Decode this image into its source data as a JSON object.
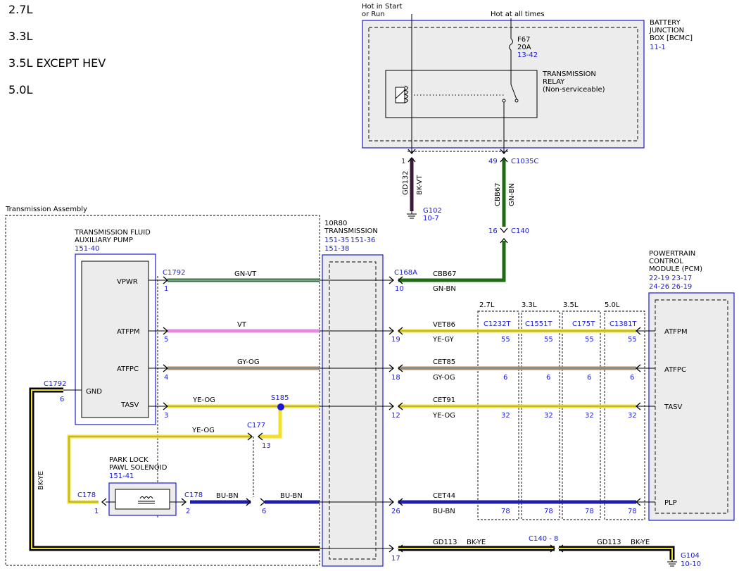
{
  "engines": [
    "2.7L",
    "3.3L",
    "3.5L EXCEPT HEV",
    "5.0L"
  ],
  "colors": {
    "blue": "#1a1ad6",
    "box_fill": "#ececec",
    "green": "#1f6b14",
    "gn_vt_stroke": "#2f6b3a",
    "violet": "#e38be0",
    "yellow": "#f1e02a",
    "gy_og": "#b08a6a",
    "bu_bn": "#1e1ea8",
    "bk_ye": "#000000"
  },
  "power": {
    "hot_start_run": [
      "Hot in Start",
      "or Run"
    ],
    "hot_all_times": "Hot at all times"
  },
  "bjb": {
    "label": [
      "BATTERY",
      "JUNCTION",
      "BOX [BCMC]"
    ],
    "ref": "11-1",
    "fuse": "F67",
    "fuse_rating": "20A",
    "fuse_ref": "13-42",
    "relay_label": [
      "TRANSMISSION",
      "RELAY",
      "(Non-serviceable)"
    ]
  },
  "top_wires": {
    "left_pin": "1",
    "left_circuit": "GD132",
    "left_color": "BK-VT",
    "ground": "G102",
    "ground_ref": "10-7",
    "right_pin": "49",
    "connector": "C1035C",
    "right_circuit": "CBB67",
    "right_color": "GN-BN",
    "c140_pin": "16",
    "c140": "C140"
  },
  "trans_assembly": "Transmission Assembly",
  "tr10r80": {
    "label": [
      "10R80",
      "TRANSMISSION"
    ],
    "refs": [
      "151-35",
      "151-36",
      "151-38"
    ]
  },
  "pump": {
    "label": [
      "TRANSMISSION FLUID",
      "AUXILIARY PUMP"
    ],
    "ref": "151-40",
    "pins": [
      "VPWR",
      "ATFPM",
      "ATFPC",
      "TASV",
      "GND"
    ]
  },
  "pcm": {
    "label": [
      "POWERTRAIN",
      "CONTROL",
      "MODULE (PCM)"
    ],
    "refs": [
      "22-19 23-17",
      "24-26 26-19"
    ],
    "pins": [
      "ATFPM",
      "ATFPC",
      "TASV",
      "PLP"
    ]
  },
  "solenoid": {
    "label": [
      "PARK LOCK",
      "PAWL SOLENOID"
    ],
    "ref": "151-41"
  },
  "wires": [
    {
      "name": "vpwr",
      "left_conn": "C1792",
      "left_pin": "1",
      "mid_color": "GN-VT",
      "right_conn": "C168A",
      "right_pin": "10",
      "circuit": "CBB67",
      "right_color": "GN-BN"
    },
    {
      "name": "atfpm",
      "left_pin": "5",
      "mid_color": "VT",
      "right_pin": "19",
      "circuit": "VET86",
      "right_color": "YE-GY",
      "pcm_pins": [
        "55",
        "55",
        "55",
        "55"
      ]
    },
    {
      "name": "atfpc",
      "left_pin": "4",
      "mid_color": "GY-OG",
      "right_pin": "18",
      "circuit": "CET85",
      "right_color": "GY-OG",
      "pcm_pins": [
        "6",
        "6",
        "6",
        "6"
      ]
    },
    {
      "name": "tasv",
      "left_pin": "3",
      "mid_color": "YE-OG",
      "splice": "S185",
      "right_pin": "12",
      "circuit": "CET91",
      "right_color": "YE-OG",
      "pcm_pins": [
        "32",
        "32",
        "32",
        "32"
      ]
    },
    {
      "name": "plp",
      "right_pin": "26",
      "circuit": "CET44",
      "right_color": "BU-BN",
      "pcm_pins": [
        "78",
        "78",
        "78",
        "78"
      ]
    }
  ],
  "pcm_variants": [
    {
      "engine": "2.7L",
      "connector": "C1232T"
    },
    {
      "engine": "3.3L",
      "connector": "C1551T"
    },
    {
      "engine": "3.5L",
      "connector": "C175T"
    },
    {
      "engine": "5.0L",
      "connector": "C1381T"
    }
  ],
  "gnd": {
    "pump_conn": "C1792",
    "pump_pin": "6",
    "color": "BK-YE",
    "right_pin": "17",
    "circuit": "GD113",
    "circuit_color": "BK-YE",
    "mid_conn": "C140 - 8",
    "ground": "G104",
    "ground_ref": "10-10"
  },
  "c177": {
    "conn": "C177",
    "pin": "13",
    "color": "YE-OG"
  },
  "c178": {
    "conn": "C178",
    "left_pin": "1",
    "right_pin": "2",
    "color": "BU-BN",
    "pin6": "6",
    "color2": "BU-BN"
  }
}
